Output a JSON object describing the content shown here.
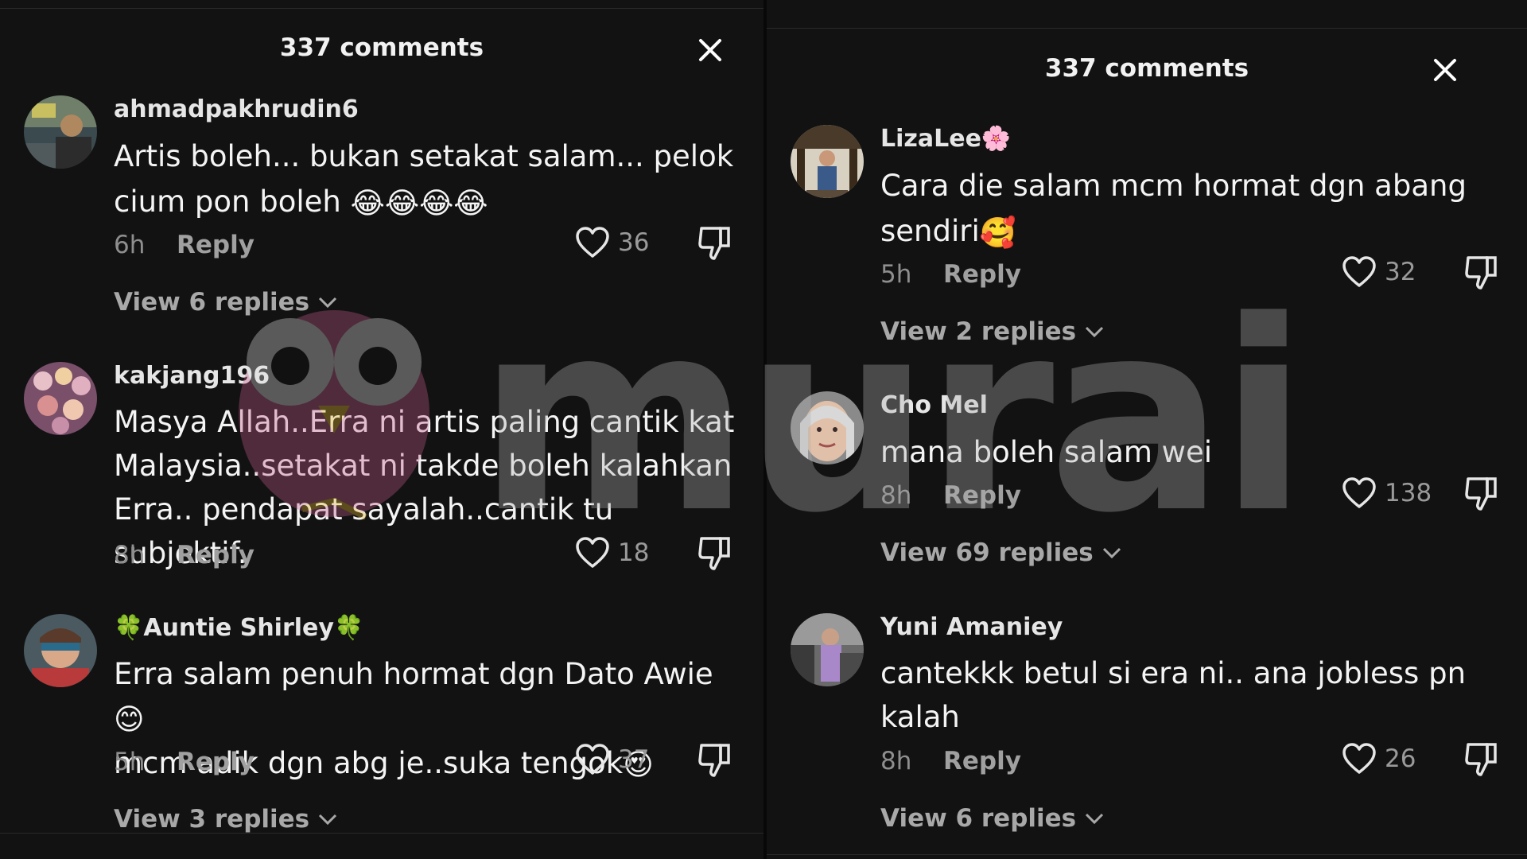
{
  "left_panel": {
    "header": "337 comments",
    "comments": [
      {
        "username": "ahmadpakhrudin6",
        "text": "Artis boleh... bukan setakat salam... pelok cium pon boleh",
        "emoji": "😂😂😂😂",
        "time": "6h",
        "reply_label": "Reply",
        "likes": "36",
        "view_replies": "View 6 replies"
      },
      {
        "username": "kakjang196",
        "text": "Masya Allah..Erra ni artis paling cantik kat Malaysia..setakat ni takde boleh kalahkan Erra.. pendapat sayalah..cantik tu subjektif.",
        "time": "8h",
        "reply_label": "Reply",
        "likes": "18"
      },
      {
        "username_prefix": "🍀",
        "username": "Auntie Shirley",
        "username_suffix": "🍀",
        "text_a": "Erra salam penuh hormat dgn Dato Awie",
        "emoji_a": "😊",
        "text_b": "mcm adik dgn abg je..suka tengok",
        "emoji_b": "😍",
        "time": "5h",
        "reply_label": "Reply",
        "likes": "37",
        "view_replies": "View 3 replies"
      }
    ]
  },
  "right_panel": {
    "header": "337 comments",
    "comments": [
      {
        "username": "LizaLee",
        "username_suffix": "🌸",
        "text": "Cara die salam mcm hormat dgn abang sendiri",
        "emoji": "🥰",
        "time": "5h",
        "reply_label": "Reply",
        "likes": "32",
        "view_replies": "View 2 replies"
      },
      {
        "username": "Cho Mel",
        "text": "mana boleh salam wei",
        "time": "8h",
        "reply_label": "Reply",
        "likes": "138",
        "view_replies": "View 69 replies"
      },
      {
        "username": "Yuni Amaniey",
        "text": "cantekkk betul si era ni.. ana jobless pn kalah",
        "time": "8h",
        "reply_label": "Reply",
        "likes": "26",
        "view_replies": "View 6 replies"
      }
    ]
  },
  "watermark": {
    "text": "murai",
    "color": "#b0b0b0",
    "bird_color": "#c05a8a"
  },
  "colors": {
    "background": "#121212",
    "text_primary": "#f4f4f4",
    "text_secondary": "#8e8e8e"
  },
  "icons": [
    "close-icon",
    "heart-icon",
    "thumbs-down-icon",
    "chevron-down-icon"
  ]
}
